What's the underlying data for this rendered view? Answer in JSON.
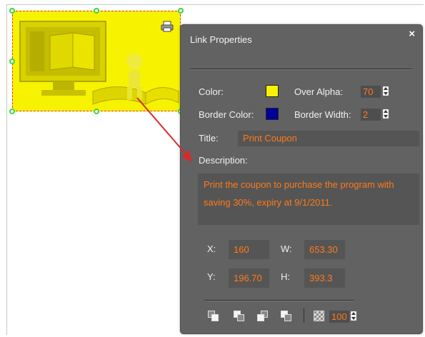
{
  "panel": {
    "title": "Link Properties",
    "close_glyph": "×",
    "color_label": "Color:",
    "over_alpha_label": "Over Alpha:",
    "over_alpha_value": "70",
    "border_color_label": "Border Color:",
    "border_width_label": "Border Width:",
    "border_width_value": "2",
    "title_label": "Title:",
    "title_value": "Print Coupon",
    "description_label": "Description:",
    "description_value": "Print the coupon to purchase the program with saving 30%, expiry at 9/1/2011.",
    "x_label": "X:",
    "x_value": "160",
    "w_label": "W:",
    "w_value": "653.30",
    "y_label": "Y:",
    "y_value": "196.70",
    "h_label": "H:",
    "h_value": "393.3",
    "opacity_value": "100"
  },
  "colors": {
    "link_fill": "#f7f300",
    "border_color": "#000099",
    "accent_text": "#ff7a1a",
    "panel_bg": "#626262",
    "handle": "#3fd43f",
    "arrow": "#d62a2a"
  },
  "icons": {
    "print": "print-icon",
    "close": "close-icon",
    "opacity": "opacity-icon",
    "arrange": [
      "bring-to-front-icon",
      "send-to-back-icon",
      "bring-forward-icon",
      "send-backward-icon"
    ]
  }
}
